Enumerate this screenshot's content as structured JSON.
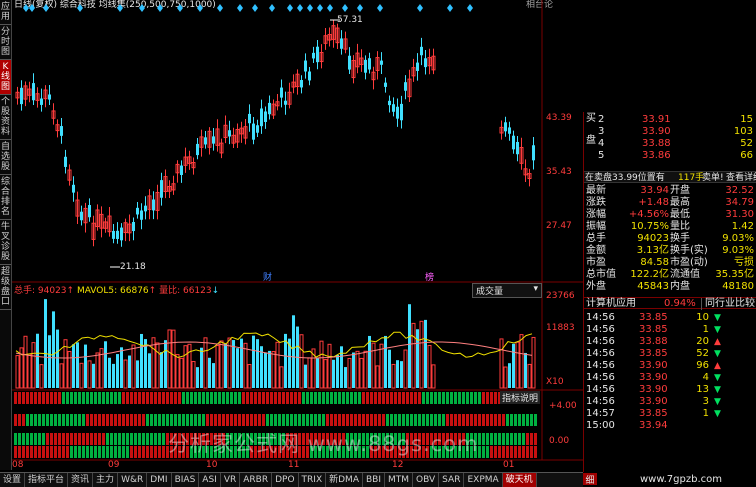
{
  "header": {
    "title": "日线(复权) 综合科技 均线集(250,500,750,1000)",
    "period_label": "相台论"
  },
  "left_nav": [
    "应用",
    "分时图",
    "K线图",
    "个股资料",
    "自选股",
    "综合排名",
    "牛叉诊股",
    "超级盘口"
  ],
  "main_chart": {
    "price_ticks": [
      "43.39",
      "35.43",
      "27.47"
    ],
    "high_label": "57.31",
    "low_label": "21.18",
    "marker_cai": "财",
    "marker_gu": "榜"
  },
  "volume_chart": {
    "legend_total": "总手: 94023",
    "legend_mavol": "MAVOL5: 66876",
    "legend_ratio": "量比: 66123",
    "volume_dropdown": "成交量",
    "ticks": [
      "23766",
      "11883"
    ],
    "unit": "X10"
  },
  "indicator_panel": {
    "title": "指标说明",
    "ticks": [
      "+4.00",
      "0.00"
    ]
  },
  "watermark": "分析家公式网 www.88gs.com",
  "watermark2": "www.7gpzb.com",
  "x_axis": [
    "08",
    "09",
    "10",
    "11",
    "12",
    "01"
  ],
  "order_book": {
    "side_label_1": "买",
    "side_label_2": "盘",
    "rows": [
      {
        "level": "2",
        "price": "33.91",
        "vol": "15"
      },
      {
        "level": "3",
        "price": "33.90",
        "vol": "103"
      },
      {
        "level": "4",
        "price": "33.88",
        "vol": "52"
      },
      {
        "level": "5",
        "price": "33.86",
        "vol": "66"
      }
    ]
  },
  "sell_note": {
    "text": "在卖盘33.99位置有",
    "count": "117手",
    "action": "卖单!",
    "link": "查看详细"
  },
  "stats": [
    {
      "l1": "最新",
      "v1": "33.94",
      "l2": "开盘",
      "v2": "32.52"
    },
    {
      "l1": "涨跌",
      "v1": "+1.48",
      "l2": "最高",
      "v2": "34.79"
    },
    {
      "l1": "涨幅",
      "v1": "+4.56%",
      "l2": "最低",
      "v2": "31.30"
    },
    {
      "l1": "振幅",
      "v1": "10.75%",
      "l2": "量比",
      "v2": "1.42"
    },
    {
      "l1": "总手",
      "v1": "94023",
      "l2": "换手",
      "v2": "9.03%"
    },
    {
      "l1": "金额",
      "v1": "3.13亿",
      "l2": "换手(实)",
      "v2": "9.03%"
    },
    {
      "l1": "市盈",
      "v1": "84.58",
      "l2": "市盈(动)",
      "v2": "亏损"
    },
    {
      "l1": "总市值",
      "v1": "122.2亿",
      "l2": "流通值",
      "v2": "35.35亿"
    },
    {
      "l1": "外盘",
      "v1": "45843",
      "l2": "内盘",
      "v2": "48180"
    }
  ],
  "industry": {
    "name": "计算机应用",
    "change": "0.94%",
    "compare": "同行业比较"
  },
  "ticks": [
    {
      "time": "14:56",
      "price": "33.85",
      "vol": "10",
      "dir": "down"
    },
    {
      "time": "14:56",
      "price": "33.85",
      "vol": "1",
      "dir": "down"
    },
    {
      "time": "14:56",
      "price": "33.88",
      "vol": "20",
      "dir": "up"
    },
    {
      "time": "14:56",
      "price": "33.85",
      "vol": "52",
      "dir": "down"
    },
    {
      "time": "14:56",
      "price": "33.90",
      "vol": "96",
      "dir": "up"
    },
    {
      "time": "14:56",
      "price": "33.90",
      "vol": "4",
      "dir": "down"
    },
    {
      "time": "14:56",
      "price": "33.90",
      "vol": "13",
      "dir": "down"
    },
    {
      "time": "14:56",
      "price": "33.90",
      "vol": "3",
      "dir": "down"
    },
    {
      "time": "14:57",
      "price": "33.85",
      "vol": "1",
      "dir": "down"
    },
    {
      "time": "15:00",
      "price": "33.94",
      "vol": "",
      "dir": ""
    }
  ],
  "bottom_tabs": [
    "设置",
    "指标平台",
    "资讯",
    "主力",
    "W&R",
    "DMI",
    "BIAS",
    "ASI",
    "VR",
    "ARBR",
    "DPO",
    "TRIX",
    "新DMA",
    "BBI",
    "MTM",
    "OBV",
    "SAR",
    "EXPMA",
    "破天机"
  ],
  "active_tab": "破天机",
  "detail_tab": "细",
  "colors": {
    "up": "#ff3c3c",
    "down": "#40e0ff",
    "green": "#00e060",
    "yellow": "#f0e000",
    "bg": "#000000"
  }
}
